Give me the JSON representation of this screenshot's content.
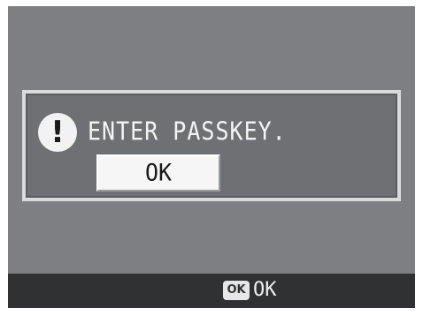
{
  "dialog": {
    "icon": "exclamation-icon",
    "message": "ENTER PASSKEY.",
    "ok_label": "OK"
  },
  "bottom_bar": {
    "key_icon": "ok-key-icon",
    "key_icon_text": "OK",
    "hint_label": "OK"
  },
  "colors": {
    "screen_bg": "#7d7f82",
    "dialog_border": "#d9dadb",
    "bar_bg": "#2f3133",
    "button_bg": "#f6f6f6"
  }
}
